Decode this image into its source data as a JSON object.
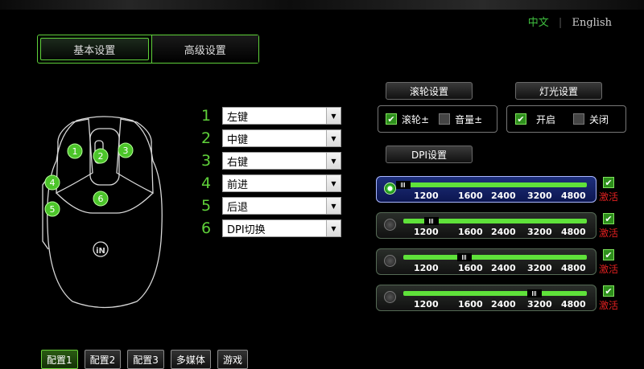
{
  "language": {
    "chinese": "中文",
    "english": "English"
  },
  "tabs": [
    {
      "label": "基本设置",
      "active": true
    },
    {
      "label": "高级设置",
      "active": false
    }
  ],
  "mouse_markers": [
    "1",
    "2",
    "3",
    "4",
    "5",
    "6"
  ],
  "key_assignments": [
    {
      "num": "1",
      "value": "左键"
    },
    {
      "num": "2",
      "value": "中键"
    },
    {
      "num": "3",
      "value": "右键"
    },
    {
      "num": "4",
      "value": "前进"
    },
    {
      "num": "5",
      "value": "后退"
    },
    {
      "num": "6",
      "value": "DPI切换"
    }
  ],
  "scroll": {
    "header": "滚轮设置",
    "options": [
      {
        "label": "滚轮±",
        "checked": true
      },
      {
        "label": "音量±",
        "checked": false
      }
    ]
  },
  "light": {
    "header": "灯光设置",
    "options": [
      {
        "label": "开启",
        "checked": true
      },
      {
        "label": "关闭",
        "checked": false
      }
    ]
  },
  "dpi": {
    "header": "DPI设置",
    "ticks": [
      "1200",
      "1600",
      "2400",
      "3200",
      "4800"
    ],
    "activate_label": "激活",
    "profiles": [
      {
        "selected": true,
        "value": "1200",
        "active": true
      },
      {
        "selected": false,
        "value": "1600",
        "active": true
      },
      {
        "selected": false,
        "value": "2400",
        "active": true
      },
      {
        "selected": false,
        "value": "4800",
        "active": true
      }
    ]
  },
  "profiles": [
    {
      "label": "配置1",
      "active": true
    },
    {
      "label": "配置2",
      "active": false
    },
    {
      "label": "配置3",
      "active": false
    },
    {
      "label": "多媒体",
      "active": false
    },
    {
      "label": "游戏",
      "active": false
    }
  ],
  "colors": {
    "accent": "#5fd13a",
    "alert": "#e02020",
    "dpi_active": "#1e2f7c"
  }
}
